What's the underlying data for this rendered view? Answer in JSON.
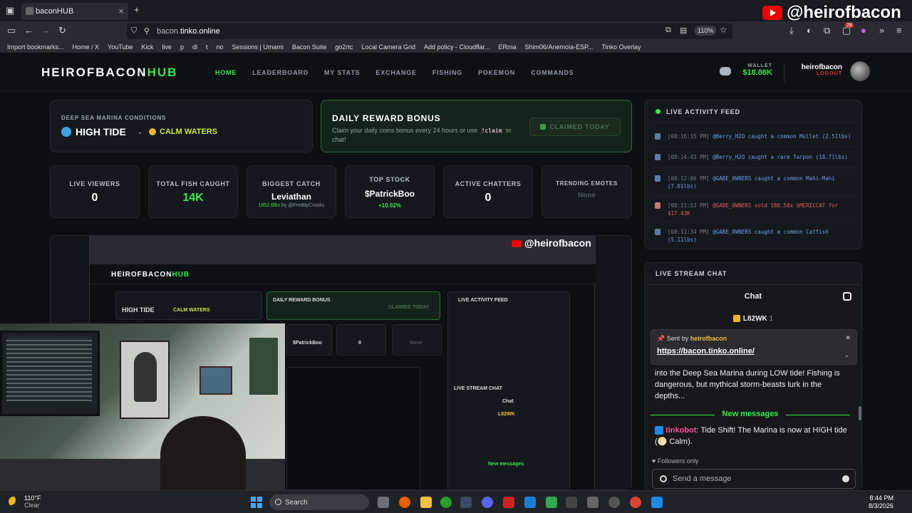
{
  "browser": {
    "tab_title": "baconHUB",
    "url_prefix": "bacon.",
    "url_domain": "tinko.online",
    "zoom": "110%",
    "bookmarks": [
      "Import bookmarks...",
      "Home / X",
      "YouTube",
      "Kick",
      "live",
      "p",
      "dl",
      "t",
      "no",
      "Sessions | Umami",
      "Bacon Suite",
      "go2rtc",
      "Local Camera Grid",
      "Add policy - Cloudflar...",
      "ERma",
      "Shim06/Anemoia-ESP...",
      "Tinko Overlay"
    ],
    "tab_count_badge": "28"
  },
  "overlay": {
    "channel_handle": "@heirofbacon"
  },
  "site": {
    "logo_main": "HEIROFBACON",
    "logo_accent": "HUB",
    "nav": [
      "HOME",
      "LEADERBOARD",
      "MY STATS",
      "EXCHANGE",
      "FISHING",
      "POKEMON",
      "COMMANDS"
    ],
    "wallet_label": "WALLET",
    "wallet_value": "$18.86K",
    "username": "heirofbacon",
    "logout_label": "LOGOUT"
  },
  "conditions": {
    "label": "DEEP SEA MARINA CONDITIONS",
    "tide": "HIGH TIDE",
    "water": "CALM WATERS"
  },
  "reward": {
    "title": "DAILY REWARD BONUS",
    "desc_before": "Claim your daily coins bonus every 24 hours or use",
    "command": "!claim",
    "desc_after": "in chat!",
    "button": "CLAIMED TODAY"
  },
  "stats": [
    {
      "label": "LIVE VIEWERS",
      "value": "0"
    },
    {
      "label": "TOTAL FISH CAUGHT",
      "value": "14K"
    },
    {
      "label": "BIGGEST CATCH",
      "value": "Leviathan",
      "sub_weight": "1852.6lbs",
      "sub_by": "by @FreddyCrooks"
    },
    {
      "label": "TOP STOCK",
      "value": "$PatrickBoo",
      "sub_change": "+10.02%"
    },
    {
      "label": "ACTIVE CHATTERS",
      "value": "0"
    },
    {
      "label": "TRENDING EMOTES",
      "value": "None"
    }
  ],
  "feed": {
    "title": "LIVE ACTIVITY FEED",
    "items": [
      {
        "time": "[08:16:15 PM]",
        "text": "@Berry_H2O caught a common Mullet (2.51lbs)",
        "icon": "fish-icon"
      },
      {
        "time": "[08:14:43 PM]",
        "text": "@Berry_H2O caught a rare Tarpon (18.71lbs)",
        "icon": "fish-icon"
      },
      {
        "time": "[08:12:06 PM]",
        "text": "@GABE_0WNERS caught a common Mahi-Mahi (7.01lbs)",
        "icon": "fish-icon"
      },
      {
        "time": "[08:11:53 PM]",
        "text": "@GABE_0WNERS sold 188.50x $MERICCAT for $17.43K",
        "icon": "chart-down-icon"
      },
      {
        "time": "[08:11:34 PM]",
        "text": "@GABE_0WNERS caught a common Catfish (5.11lbs)",
        "icon": "fish-icon"
      }
    ]
  },
  "chat": {
    "panel_title": "LIVE STREAM CHAT",
    "header": "Chat",
    "leader": "L82WK",
    "leader_count": "1",
    "pinned_by_label": "Sent by",
    "pinned_by": "heirofbacon",
    "pinned_link": "https://bacon.tinko.online/",
    "old_message": "into the Deep Sea Marina during LOW tide! Fishing is dangerous, but mythical storm-beasts lurk in the depths...",
    "new_messages_label": "New messages",
    "bot_name": "tinkobot",
    "bot_message": "Tide Shift! The Marina is now at HIGH tide (🌕 Calm).",
    "followers_only": "Followers only",
    "input_placeholder": "Send a message"
  },
  "taskbar": {
    "temperature": "110°F",
    "condition": "Clear",
    "search_label": "Search",
    "time": "8:44 PM",
    "date": "8/3/2026"
  }
}
